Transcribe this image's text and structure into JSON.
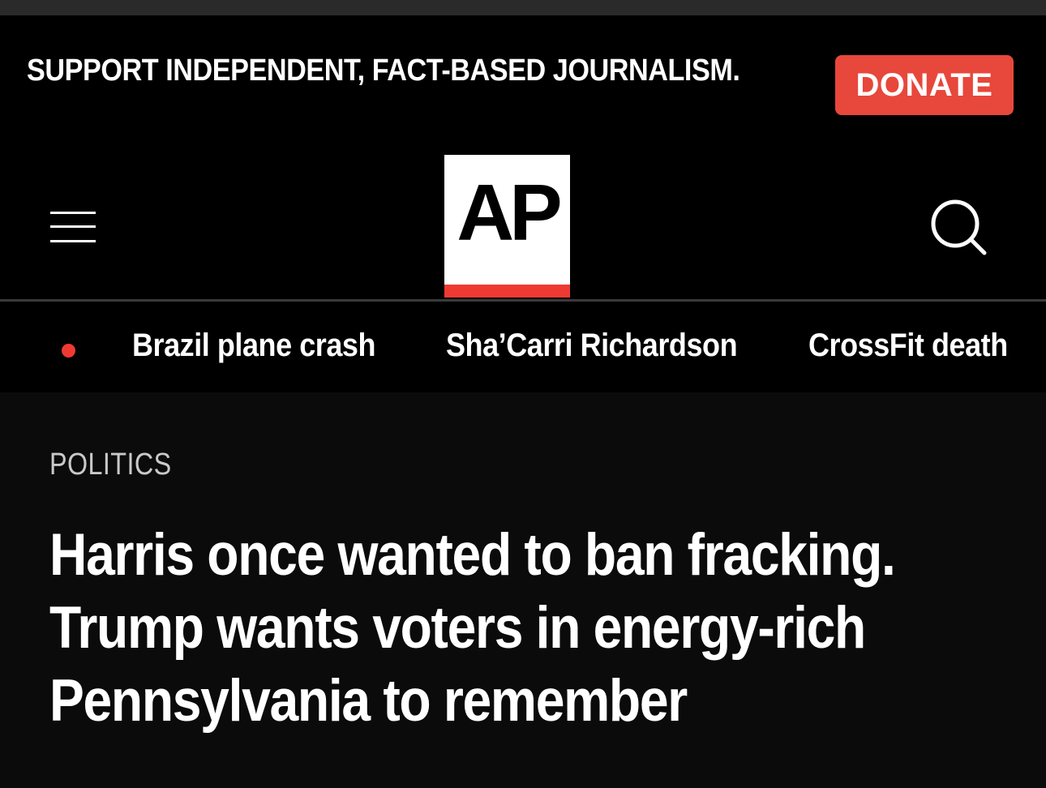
{
  "support_bar": {
    "message": "SUPPORT INDEPENDENT, FACT-BASED JOURNALISM.",
    "donate_label": "DONATE"
  },
  "header": {
    "logo_text": "AP",
    "menu_icon": "hamburger-menu-icon",
    "search_icon": "search-icon"
  },
  "trending": {
    "live_indicator": "red-dot-icon",
    "items": [
      {
        "label": "Brazil plane crash"
      },
      {
        "label": "Sha’Carri Richardson"
      },
      {
        "label": "CrossFit death"
      }
    ]
  },
  "article": {
    "section": "POLITICS",
    "headline_lines": [
      "Harris once wanted to ban fracking.",
      "Trump wants voters in energy-rich",
      "Pennsylvania to remember"
    ]
  },
  "colors": {
    "background": "#0b0b0b",
    "donate": "#e8473b",
    "ap_red": "#ef3a33",
    "section_gray": "#c9c9c9"
  }
}
